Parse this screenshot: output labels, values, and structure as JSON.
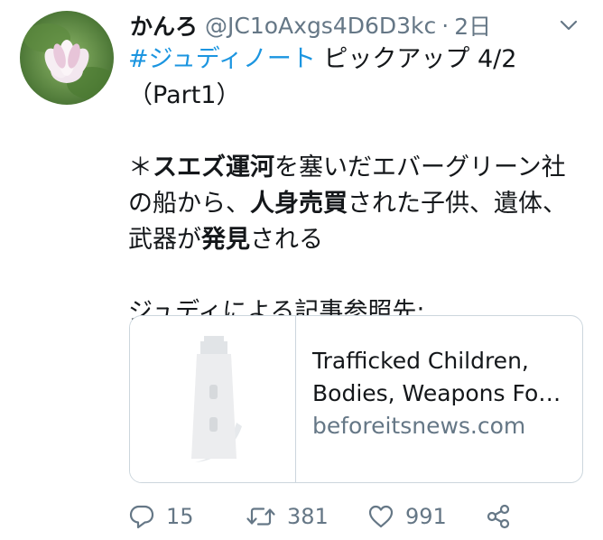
{
  "tweet": {
    "author": {
      "display_name": "かんろ",
      "handle": "@JC1oAxgs4D6D3kc",
      "separator": "·",
      "time": "2日"
    },
    "body": {
      "hashtag": "#ジュディノート",
      "line1_rest": " ピックアップ 4/2",
      "line2": "（Part1）",
      "p2_prefix": "＊",
      "p2_bold1": "スエズ運河",
      "p2_text1": "を塞いだエバーグリーン社の船から、",
      "p2_bold2": "人身売買",
      "p2_text2": "された子供、遺体、武器が",
      "p2_bold3": "発見",
      "p2_text3": "される",
      "p3": "ジュディによる記事参照先:"
    },
    "card": {
      "title": "Trafficked Children, Bodies, Weapons Fo…",
      "domain": "beforeitsnews.com"
    },
    "actions": {
      "reply_count": "15",
      "retweet_count": "381",
      "like_count": "991"
    }
  },
  "icons": {
    "reply": "speech-bubble-icon",
    "retweet": "retweet-arrows-icon",
    "like": "heart-icon",
    "share": "share-icon",
    "more": "chevron-down-icon"
  },
  "colors": {
    "link": "#1b95e0",
    "secondary": "#657786",
    "text": "#14171a",
    "border": "#ccd6dd"
  }
}
